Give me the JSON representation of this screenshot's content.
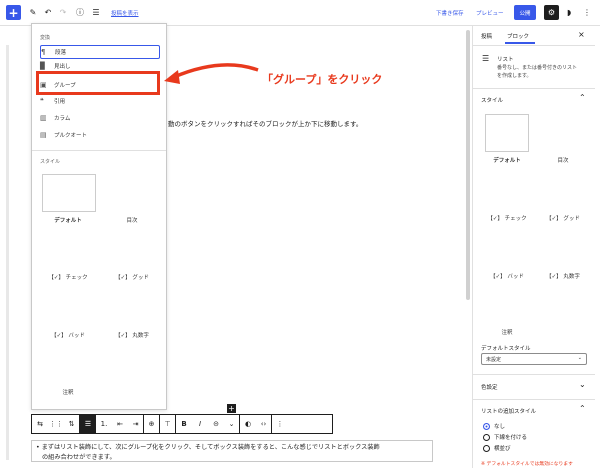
{
  "topbar": {
    "add": "+",
    "link_label": "投稿を表示",
    "save_draft": "下書き保存",
    "preview": "プレビュー",
    "publish": "公開"
  },
  "block_menu": {
    "section_label": "変換",
    "items": [
      {
        "icon": "¶",
        "label": "段落"
      },
      {
        "icon": "▉",
        "label": "見出し"
      },
      {
        "icon": "▣",
        "label": "グループ"
      },
      {
        "icon": "❝",
        "label": "引用"
      },
      {
        "icon": "▥",
        "label": "カラム"
      },
      {
        "icon": "▤",
        "label": "プルクオート"
      }
    ],
    "styles_label": "スタイル",
    "styles": [
      {
        "label": "デフォルト"
      },
      {
        "label": "目次"
      },
      {
        "label": "【✓】 チェック"
      },
      {
        "label": "【✓】 グッド"
      },
      {
        "label": "【✓】 バッド"
      },
      {
        "label": "【✓】 丸数字"
      },
      {
        "label": "注釈"
      }
    ]
  },
  "callout": {
    "text": "「グループ」をクリック"
  },
  "document": {
    "line": "動のボタンをクリックすればそのブロックが上か下に移動します。"
  },
  "sidebar": {
    "tabs": [
      {
        "label": "投稿"
      },
      {
        "label": "ブロック"
      }
    ],
    "close": "×",
    "block_title": "リスト",
    "block_desc_1": "番号なし、または番号付きのリスト",
    "block_desc_2": "を作成します。",
    "styles_label": "スタイル",
    "styles": [
      {
        "label": "デフォルト"
      },
      {
        "label": "目次"
      },
      {
        "label": "【✓】 チェック"
      },
      {
        "label": "【✓】 グッド"
      },
      {
        "label": "【✓】 バッド"
      },
      {
        "label": "【✓】 丸数字"
      },
      {
        "label": "注釈"
      }
    ],
    "default_style_label": "デフォルトスタイル",
    "default_style_value": "未設定",
    "color_label": "色設定",
    "list_style_label": "リストの追加スタイル",
    "radio": [
      {
        "label": "なし",
        "checked": true
      },
      {
        "label": "下線を付ける",
        "checked": false
      },
      {
        "label": "横並び",
        "checked": false
      }
    ],
    "warning": "※ デフォルトスタイルでは無効になります"
  },
  "toolbar": {
    "tools": [
      {
        "icon": "⇆"
      },
      {
        "icon": "⋮⋮"
      },
      {
        "icon": "⇅"
      },
      {
        "icon": "☰"
      },
      {
        "icon": "1."
      },
      {
        "icon": "⇤"
      },
      {
        "icon": "⇥"
      },
      {
        "icon": "⊕"
      },
      {
        "icon": "⊤"
      },
      {
        "icon": "B"
      },
      {
        "icon": "I"
      },
      {
        "icon": "⊝"
      },
      {
        "icon": "⌄"
      },
      {
        "icon": "◐"
      },
      {
        "icon": "‹›"
      },
      {
        "icon": "⋮"
      }
    ]
  },
  "bottom": {
    "line1": "• まずはリスト装飾にして、次にグループ化をクリック、そしてボックス装飾をすると、こんな感じでリストとボックス装飾",
    "line2": "の組み合わせができます。"
  },
  "colors": {
    "accent": "#3858e9",
    "callout": "#e8391d"
  }
}
